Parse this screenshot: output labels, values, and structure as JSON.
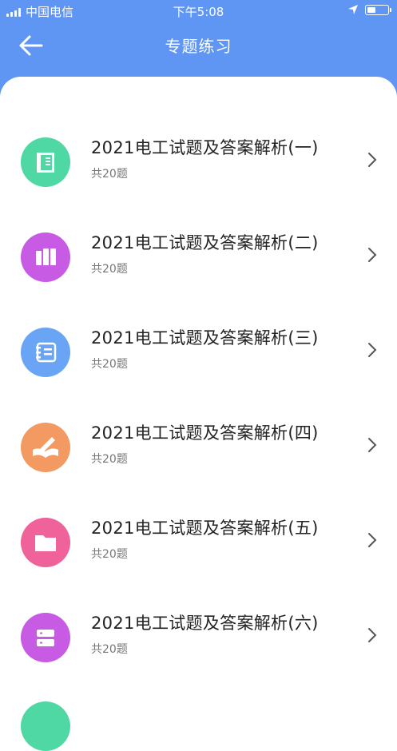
{
  "status_bar": {
    "carrier": "中国电信",
    "time": "下午5:08",
    "battery_level": 0.45
  },
  "header": {
    "title": "专题练习",
    "back_icon": "arrow-left-icon"
  },
  "colors": {
    "header_bg": "#5f95f3",
    "badge_green": "#4fd8a3",
    "badge_purple": "#c85be3",
    "badge_blue": "#6aa5f5",
    "badge_orange": "#f39a63",
    "badge_pink": "#f0629a"
  },
  "items": [
    {
      "title": "2021电工试题及答案解析(一)",
      "subtitle": "共20题",
      "icon": "notebook-icon",
      "color": "#4fd8a3"
    },
    {
      "title": "2021电工试题及答案解析(二)",
      "subtitle": "共20题",
      "icon": "books-icon",
      "color": "#c85be3"
    },
    {
      "title": "2021电工试题及答案解析(三)",
      "subtitle": "共20题",
      "icon": "book-list-icon",
      "color": "#6aa5f5"
    },
    {
      "title": "2021电工试题及答案解析(四)",
      "subtitle": "共20题",
      "icon": "open-book-pencil-icon",
      "color": "#f39a63"
    },
    {
      "title": "2021电工试题及答案解析(五)",
      "subtitle": "共20题",
      "icon": "folder-icon",
      "color": "#f0629a"
    },
    {
      "title": "2021电工试题及答案解析(六)",
      "subtitle": "共20题",
      "icon": "server-icon",
      "color": "#c85be3"
    }
  ]
}
